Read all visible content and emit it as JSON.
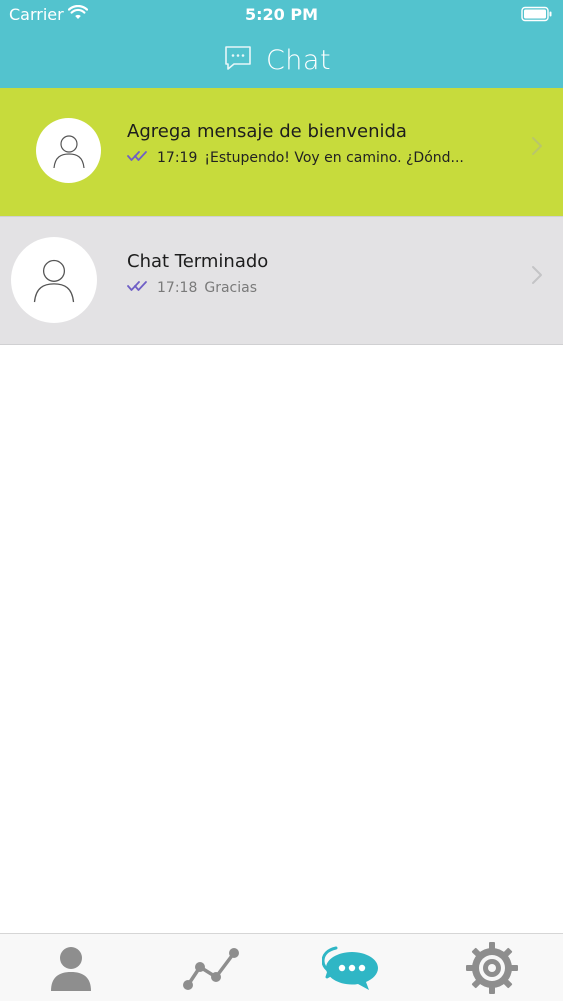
{
  "status_bar": {
    "carrier": "Carrier",
    "time": "5:20 PM"
  },
  "header": {
    "title": "Chat",
    "icon": "chat-bubble-icon"
  },
  "chats": [
    {
      "name": "Agrega mensaje de bienvenida",
      "time": "17:19",
      "preview": "¡Estupendo! Voy en camino. ¿Dónd...",
      "read_status": "double-check-icon"
    },
    {
      "name": "Chat Terminado",
      "time": "17:18",
      "preview": "Gracias",
      "read_status": "double-check-icon"
    }
  ],
  "tabbar": {
    "tabs": [
      {
        "icon": "profile-icon",
        "active": false
      },
      {
        "icon": "stats-icon",
        "active": false
      },
      {
        "icon": "chat-icon",
        "active": true
      },
      {
        "icon": "gear-icon",
        "active": false
      }
    ]
  },
  "colors": {
    "header": "#53c3ce",
    "selected_row": "#c7db3c",
    "row": "#e3e2e4",
    "check": "#6f5fc6",
    "active_tab": "#2fb6c5",
    "inactive_tab": "#8e8e8e"
  }
}
